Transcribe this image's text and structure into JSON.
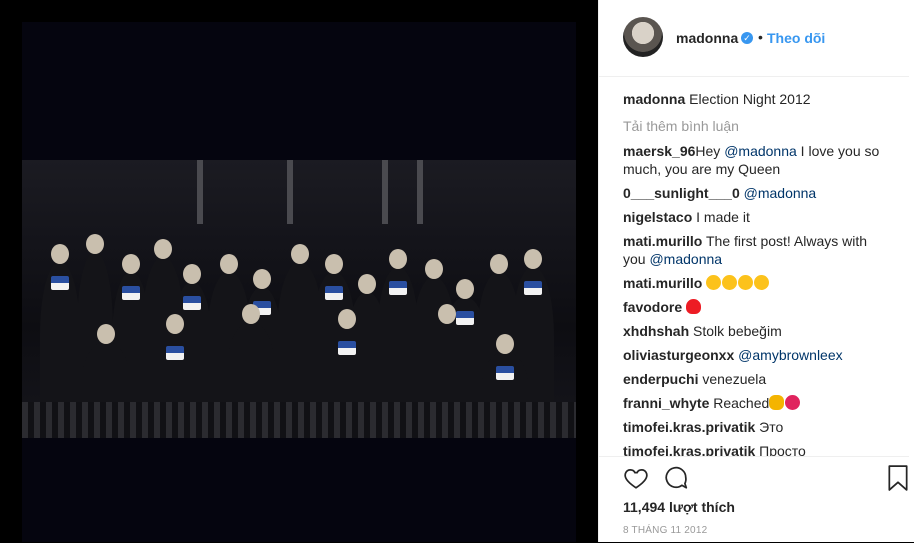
{
  "header": {
    "username": "madonna",
    "separator": "•",
    "follow_label": "Theo dõi"
  },
  "caption": {
    "username": "madonna",
    "text": "Election Night 2012"
  },
  "load_more": "Tải thêm bình luận",
  "comments": [
    {
      "user": "maersk_96",
      "pre": "Hey ",
      "mention": "@madonna",
      "post": " I love you so much, you are my Queen"
    },
    {
      "user": "0___sunlight___0",
      "pre": " ",
      "mention": "@madonna",
      "post": ""
    },
    {
      "user": "nigelstaco",
      "pre": " I made it",
      "mention": "",
      "post": ""
    },
    {
      "user": "mati.murillo",
      "pre": " The first post! Always with you ",
      "mention": "@madonna",
      "post": ""
    },
    {
      "user": "mati.murillo",
      "pre": " ",
      "mention": "",
      "post": "",
      "emojis": [
        "heart-eyes",
        "heart-eyes",
        "kiss",
        "kiss"
      ]
    },
    {
      "user": "favodore",
      "pre": " ",
      "mention": "",
      "post": "",
      "emojis": [
        "red-heart"
      ]
    },
    {
      "user": "xhdhshah",
      "pre": " Stolk bebeğim",
      "mention": "",
      "post": ""
    },
    {
      "user": "oliviasturgeonxx",
      "pre": " ",
      "mention": "@amybrownleex",
      "post": ""
    },
    {
      "user": "enderpuchi",
      "pre": " venezuela",
      "mention": "",
      "post": ""
    },
    {
      "user": "franni_whyte",
      "pre": " Reached",
      "mention": "",
      "post": "",
      "emojis": [
        "flexed-biceps",
        "sparkling-heart"
      ]
    },
    {
      "user": "timofei.kras.privatik",
      "pre": " Это",
      "mention": "",
      "post": ""
    },
    {
      "user": "timofei.kras.privatik",
      "pre": " Просто",
      "mention": "",
      "post": ""
    }
  ],
  "likes": "11,494 lượt thích",
  "date": "8 THÁNG 11 2012",
  "colors": {
    "accent": "#3897f0",
    "text": "#262626",
    "muted": "#999999",
    "heart": "#ed4956"
  }
}
